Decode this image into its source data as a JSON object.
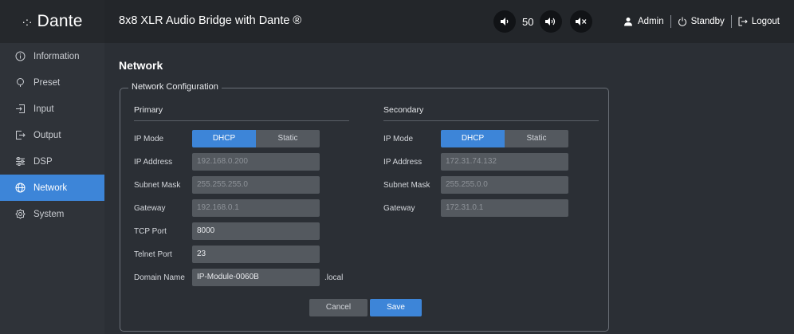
{
  "brand": {
    "text": "Dante",
    "mark": "·:·"
  },
  "app_title": "8x8 XLR Audio Bridge with Dante ®",
  "volume": {
    "value": "50"
  },
  "user": {
    "name": "Admin",
    "standby_label": "Standby",
    "logout_label": "Logout"
  },
  "nav": [
    {
      "label": "Information",
      "icon": "info-icon",
      "active": false
    },
    {
      "label": "Preset",
      "icon": "pin-icon",
      "active": false
    },
    {
      "label": "Input",
      "icon": "input-icon",
      "active": false
    },
    {
      "label": "Output",
      "icon": "output-icon",
      "active": false
    },
    {
      "label": "DSP",
      "icon": "sliders-icon",
      "active": false
    },
    {
      "label": "Network",
      "icon": "globe-icon",
      "active": true
    },
    {
      "label": "System",
      "icon": "gear-icon",
      "active": false
    }
  ],
  "page_title": "Network",
  "network": {
    "legend": "Network Configuration",
    "primary": {
      "title": "Primary",
      "ip_mode_label": "IP Mode",
      "dhcp_label": "DHCP",
      "static_label": "Static",
      "ip_label": "IP Address",
      "ip_value": "192.168.0.200",
      "mask_label": "Subnet Mask",
      "mask_value": "255.255.255.0",
      "gateway_label": "Gateway",
      "gateway_value": "192.168.0.1",
      "tcp_label": "TCP Port",
      "tcp_value": "8000",
      "telnet_label": "Telnet Port",
      "telnet_value": "23",
      "domain_label": "Domain Name",
      "domain_value": "IP-Module-0060B",
      "domain_suffix": ".local"
    },
    "secondary": {
      "title": "Secondary",
      "ip_mode_label": "IP Mode",
      "dhcp_label": "DHCP",
      "static_label": "Static",
      "ip_label": "IP Address",
      "ip_value": "172.31.74.132",
      "mask_label": "Subnet Mask",
      "mask_value": "255.255.0.0",
      "gateway_label": "Gateway",
      "gateway_value": "172.31.0.1"
    },
    "cancel_label": "Cancel",
    "save_label": "Save"
  },
  "colors": {
    "accent": "#3d85d8",
    "sidebar": "#2f3339",
    "topbar": "#23262a",
    "content": "#2b2f35",
    "field": "#54595f"
  }
}
